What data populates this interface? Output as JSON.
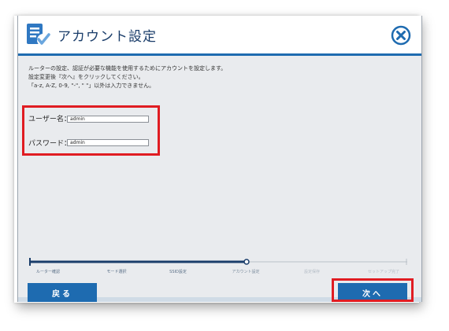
{
  "window": {
    "title": "アカウント設定",
    "icon": "checklist-icon",
    "close_icon": "close-circle-icon"
  },
  "description": {
    "lines": [
      "ルーターの設定、認証が必要な機能を使用するためにアカウントを設定します。",
      "設定変更後『次へ』をクリックしてください。",
      "「a-z, A-Z, 0-9, \"-\", \" \"」以外は入力できません。"
    ]
  },
  "form": {
    "username": {
      "label": "ユーザー名：",
      "value": "admin"
    },
    "password": {
      "label": "パスワード：",
      "value": "admin"
    }
  },
  "steps": {
    "items": [
      {
        "label": "ルーター確認",
        "state": "done"
      },
      {
        "label": "モード選択",
        "state": "done"
      },
      {
        "label": "SSID設定",
        "state": "done"
      },
      {
        "label": "アカウント設定",
        "state": "current"
      },
      {
        "label": "設定保存",
        "state": "future"
      },
      {
        "label": "セットアップ完了",
        "state": "future"
      }
    ]
  },
  "buttons": {
    "back_label": "戻る",
    "next_label": "次へ"
  },
  "colors": {
    "accent": "#1e6bb0",
    "highlight": "#e01c22",
    "background": "#e9ebee"
  }
}
